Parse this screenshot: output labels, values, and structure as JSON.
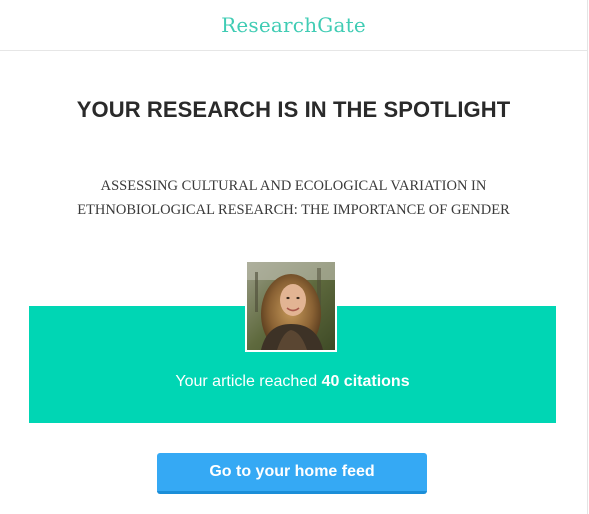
{
  "header": {
    "brand": "ResearchGate"
  },
  "headline": "YOUR RESEARCH IS IN THE SPOTLIGHT",
  "paper": {
    "title_line1": "ASSESSING CULTURAL AND ECOLOGICAL VARIATION IN",
    "title_line2": "ETHNOBIOLOGICAL RESEARCH: THE IMPORTANCE OF GENDER"
  },
  "milestone": {
    "prefix": "Your article reached ",
    "highlight": "40 citations"
  },
  "cta": {
    "label": "Go to your home feed"
  },
  "colors": {
    "brand": "#40ccb4",
    "band": "#00d6b4",
    "button": "#35a9f4"
  }
}
